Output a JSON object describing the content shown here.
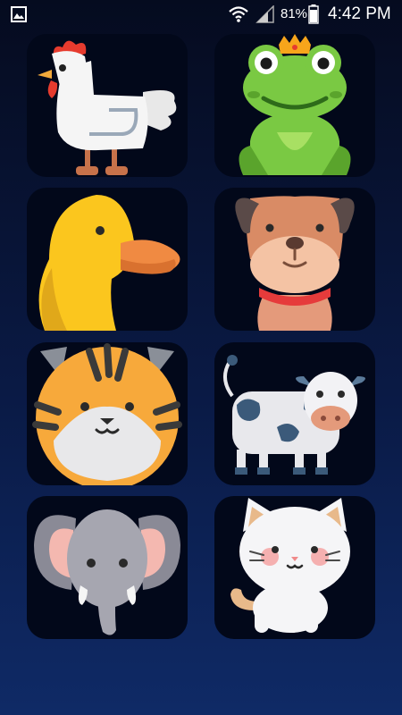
{
  "status_bar": {
    "battery_percent": "81%",
    "time": "4:42 PM",
    "icons": [
      "gallery-icon",
      "wifi-icon",
      "signal-icon",
      "battery-icon"
    ]
  },
  "tiles": [
    {
      "animal": "chicken",
      "icon": "chicken-icon"
    },
    {
      "animal": "frog",
      "icon": "frog-icon"
    },
    {
      "animal": "duck",
      "icon": "duck-icon"
    },
    {
      "animal": "dog",
      "icon": "dog-icon"
    },
    {
      "animal": "tiger",
      "icon": "tiger-icon"
    },
    {
      "animal": "cow",
      "icon": "cow-icon"
    },
    {
      "animal": "elephant",
      "icon": "elephant-icon"
    },
    {
      "animal": "cat",
      "icon": "cat-icon"
    }
  ],
  "colors": {
    "background_top": "#050b1f",
    "background_bottom": "#0f2a66",
    "tile_background": "#02081a"
  }
}
